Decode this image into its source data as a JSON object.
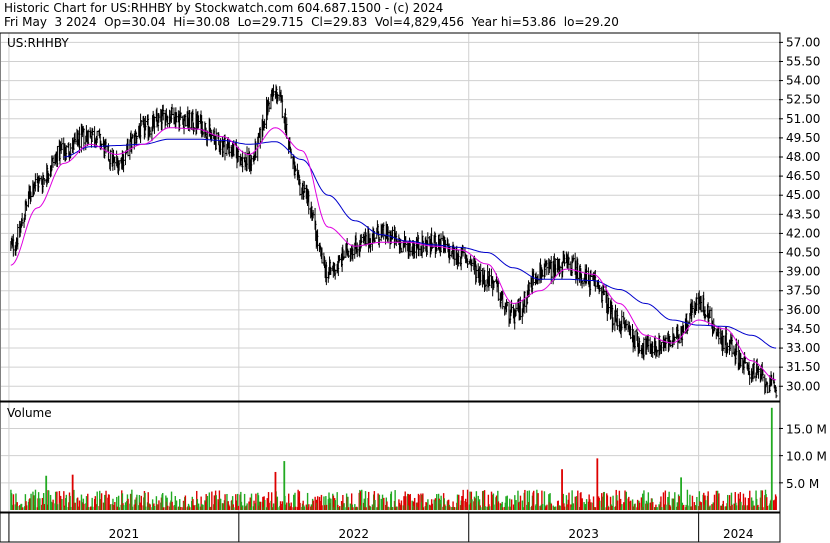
{
  "header": {
    "line1": "Historic Chart for US:RHHBY by Stockwatch.com 604.687.1500 - (c) 2024",
    "line2": "Fri May  3 2024  Op=30.04  Hi=30.08  Lo=29.715  Cl=29.83  Vol=4,829,456  Year hi=53.86  lo=29.20"
  },
  "price_panel": {
    "label": "US:RHHBY"
  },
  "volume_panel": {
    "label": "Volume"
  },
  "colors": {
    "candle": "#000000",
    "ma_short": "#e000e0",
    "ma_long": "#0000cc",
    "vol_up": "#22aa22",
    "vol_down": "#dd0000",
    "grid": "#d0d0d0"
  },
  "chart_data": [
    {
      "type": "line",
      "title": "US:RHHBY",
      "x": [
        "2021-01-04",
        "2021-02-15",
        "2021-03-29",
        "2021-05-10",
        "2021-06-21",
        "2021-08-02",
        "2021-09-13",
        "2021-10-25",
        "2021-12-06",
        "2022-01-17",
        "2022-02-28",
        "2022-04-11",
        "2022-05-23",
        "2022-07-04",
        "2022-08-15",
        "2022-09-26",
        "2022-11-07",
        "2022-12-19",
        "2023-01-30",
        "2023-03-13",
        "2023-04-24",
        "2023-06-05",
        "2023-07-17",
        "2023-08-28",
        "2023-10-09",
        "2023-11-20",
        "2024-01-01",
        "2024-02-12",
        "2024-03-25",
        "2024-05-03"
      ],
      "series": [
        {
          "name": "",
          "role": "close",
          "values": [
            41.0,
            46.0,
            48.5,
            49.8,
            47.6,
            50.2,
            51.3,
            50.7,
            49.0,
            47.6,
            53.0,
            45.5,
            39.0,
            41.0,
            42.0,
            41.0,
            41.2,
            40.2,
            38.5,
            35.5,
            39.0,
            39.6,
            38.2,
            35.0,
            33.0,
            33.5,
            36.5,
            33.5,
            31.2,
            29.83
          ]
        },
        {
          "name": "",
          "role": "ma_short",
          "values": [
            39.5,
            44.0,
            47.5,
            49.0,
            48.2,
            49.0,
            50.3,
            50.2,
            49.6,
            48.2,
            50.3,
            48.5,
            42.5,
            41.0,
            41.3,
            41.3,
            41.0,
            40.7,
            39.6,
            36.5,
            37.5,
            39.2,
            38.8,
            36.5,
            34.0,
            33.4,
            35.2,
            34.5,
            32.0,
            30.5
          ]
        },
        {
          "name": "",
          "role": "ma_long",
          "values": [
            null,
            null,
            48.0,
            48.8,
            48.9,
            49.0,
            49.4,
            49.4,
            49.3,
            49.0,
            49.2,
            47.8,
            45.0,
            43.0,
            41.9,
            41.4,
            41.1,
            40.9,
            40.5,
            39.3,
            38.4,
            38.4,
            38.3,
            37.6,
            36.5,
            35.2,
            34.8,
            34.7,
            34.0,
            33.0
          ]
        }
      ],
      "xlabel": "",
      "ylabel": "",
      "ylim": [
        29.0,
        57.5
      ],
      "y_ticks": [
        "57.00",
        "55.50",
        "54.00",
        "52.50",
        "51.00",
        "49.50",
        "48.00",
        "46.50",
        "45.00",
        "43.50",
        "42.00",
        "40.50",
        "39.00",
        "37.50",
        "36.00",
        "34.50",
        "33.00",
        "31.50",
        "30.00"
      ],
      "x_tick_labels": [
        "2021",
        "2022",
        "2023",
        "2024"
      ],
      "grid": true,
      "year_hi": 53.86,
      "year_lo": 29.2
    },
    {
      "type": "bar",
      "title": "Volume",
      "y_ticks": [
        "15.0 M",
        "10.0 M",
        "5.0 M"
      ],
      "ylim": [
        0,
        19.5
      ],
      "unit": "M",
      "notable_values": [
        {
          "date": "2024-04-26",
          "value": 18.8,
          "direction": "up"
        },
        {
          "date": "2023-07-24",
          "value": 9.5,
          "direction": "down"
        },
        {
          "date": "2022-03-14",
          "value": 9.0,
          "direction": "up"
        },
        {
          "date": "2023-05-29",
          "value": 7.5,
          "direction": "down"
        },
        {
          "date": "2022-02-28",
          "value": 7.0,
          "direction": "down"
        },
        {
          "date": "2021-04-12",
          "value": 6.5,
          "direction": "down"
        },
        {
          "date": "2021-03-01",
          "value": 6.3,
          "direction": "up"
        },
        {
          "date": "2023-12-04",
          "value": 6.0,
          "direction": "up"
        }
      ],
      "typical_range": [
        0.5,
        3.0
      ]
    }
  ]
}
